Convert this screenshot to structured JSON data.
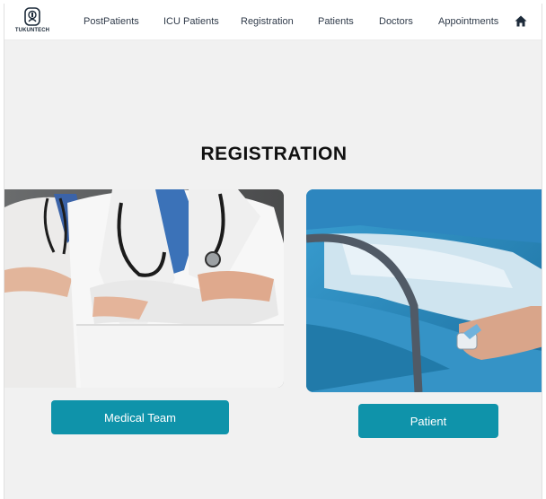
{
  "brand": {
    "name": "TUKUNTECH",
    "icon": "shield-logo-icon"
  },
  "nav": {
    "items": [
      {
        "label": "PostPatients"
      },
      {
        "label": "ICU Patients"
      },
      {
        "label": "Registration"
      },
      {
        "label": "Patients"
      },
      {
        "label": "Doctors"
      },
      {
        "label": "Appointments"
      }
    ],
    "home_icon": "home-icon"
  },
  "main": {
    "title": "REGISTRATION",
    "cards": [
      {
        "image": "doctors-photo",
        "button_label": "Medical Team"
      },
      {
        "image": "patient-photo",
        "button_label": "Patient"
      }
    ]
  },
  "colors": {
    "background": "#f1f1f1",
    "navbar": "#ffffff",
    "button": "#0f93aa",
    "button_text": "#ffffff",
    "title": "#111111"
  }
}
